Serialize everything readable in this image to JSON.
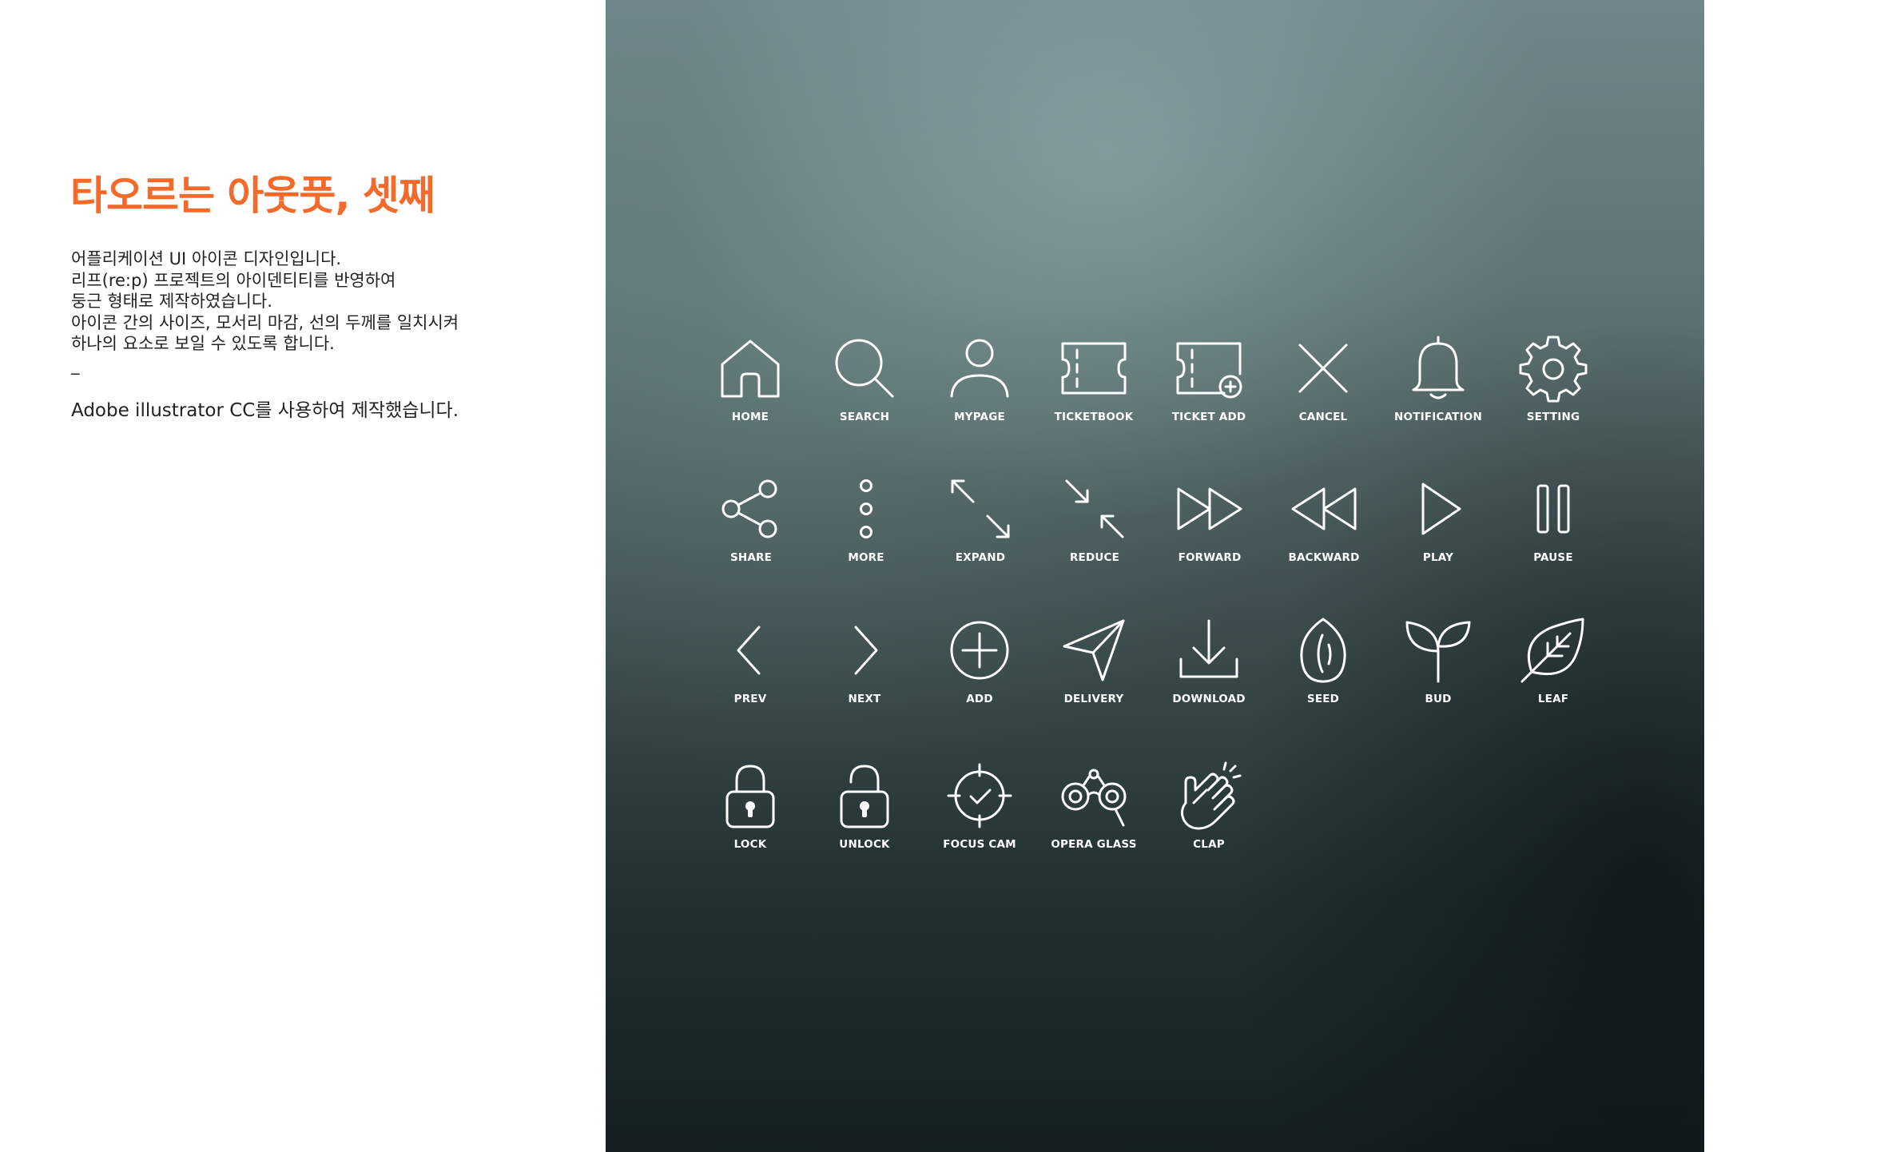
{
  "title": "타오르는 아웃풋, 셋째",
  "description": {
    "lines": [
      "어플리케이션 UI 아이콘 디자인입니다.",
      "리프(re:p) 프로젝트의 아이덴티티를 반영하여",
      "둥근 형태로 제작하였습니다.",
      "아이콘 간의 사이즈, 모서리 마감, 선의 두께를 일치시켜",
      "하나의 요소로 보일 수 있도록 합니다.",
      "_"
    ],
    "tool_note": "Adobe illustrator CC를 사용하여 제작했습니다."
  },
  "colors": {
    "title": "#f36a2a",
    "icon": "#ffffff"
  },
  "icons": [
    {
      "icon": "home-icon",
      "label": "HOME"
    },
    {
      "icon": "search-icon",
      "label": "SEARCH"
    },
    {
      "icon": "mypage-icon",
      "label": "MYPAGE"
    },
    {
      "icon": "ticketbook-icon",
      "label": "TICKETBOOK"
    },
    {
      "icon": "ticket-add-icon",
      "label": "TICKET ADD"
    },
    {
      "icon": "cancel-icon",
      "label": "CANCEL"
    },
    {
      "icon": "notification-icon",
      "label": "NOTIFICATION"
    },
    {
      "icon": "setting-icon",
      "label": "SETTING"
    },
    {
      "icon": "share-icon",
      "label": "SHARE"
    },
    {
      "icon": "more-icon",
      "label": "MORE"
    },
    {
      "icon": "expand-icon",
      "label": "EXPAND"
    },
    {
      "icon": "reduce-icon",
      "label": "REDUCE"
    },
    {
      "icon": "forward-icon",
      "label": "FORWARD"
    },
    {
      "icon": "backward-icon",
      "label": "BACKWARD"
    },
    {
      "icon": "play-icon",
      "label": "PLAY"
    },
    {
      "icon": "pause-icon",
      "label": "PAUSE"
    },
    {
      "icon": "prev-icon",
      "label": "PREV"
    },
    {
      "icon": "next-icon",
      "label": "NEXT"
    },
    {
      "icon": "add-icon",
      "label": "ADD"
    },
    {
      "icon": "delivery-icon",
      "label": "DELIVERY"
    },
    {
      "icon": "download-icon",
      "label": "DOWNLOAD"
    },
    {
      "icon": "seed-icon",
      "label": "SEED"
    },
    {
      "icon": "bud-icon",
      "label": "BUD"
    },
    {
      "icon": "leaf-icon",
      "label": "LEAF"
    },
    {
      "icon": "lock-icon",
      "label": "LOCK"
    },
    {
      "icon": "unlock-icon",
      "label": "UNLOCK"
    },
    {
      "icon": "focus-cam-icon",
      "label": "FOCUS CAM"
    },
    {
      "icon": "opera-glass-icon",
      "label": "OPERA GLASS"
    },
    {
      "icon": "clap-icon",
      "label": "CLAP"
    }
  ]
}
